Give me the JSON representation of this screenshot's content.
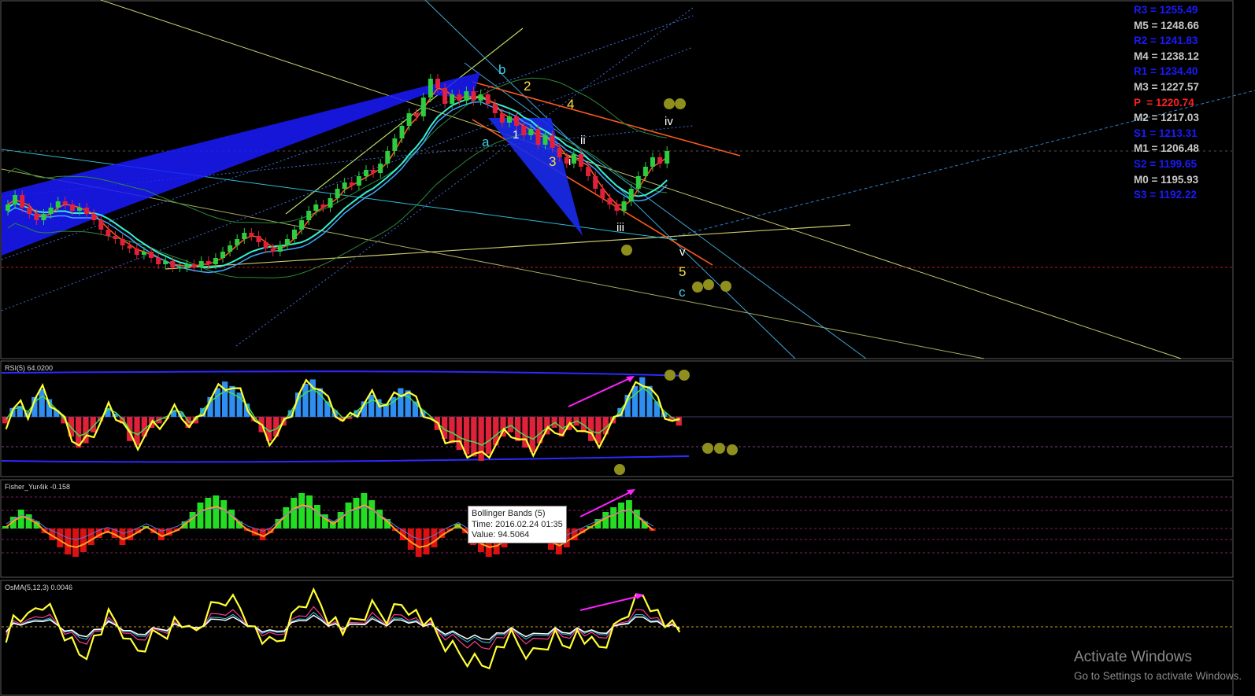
{
  "colors": {
    "background": "#000000",
    "bull_candle": "#2ecc40",
    "bear_candle": "#e0213a",
    "rsi_up_hist": "#2f8ff0",
    "rsi_down_hist": "#e0213a",
    "fisher_up_hist": "#22dd22",
    "fisher_down_hist": "#dd1111",
    "signal_yellow": "#ffff33",
    "annotation_arrow": "#ff22ff",
    "marker_dot": "#8f8f1e",
    "pivot_resistance": "#1a1aff",
    "pivot_mid": "#c8c8c8",
    "pivot_main": "#ff2020"
  },
  "pivots": [
    {
      "label": "R3 = 1255.49",
      "kind": "resistance"
    },
    {
      "label": "M5 = 1248.66",
      "kind": "mid"
    },
    {
      "label": "R2 = 1241.83",
      "kind": "resistance"
    },
    {
      "label": "M4 = 1238.12",
      "kind": "mid"
    },
    {
      "label": "R1 = 1234.40",
      "kind": "resistance"
    },
    {
      "label": "M3 = 1227.57",
      "kind": "mid"
    },
    {
      "label": "P  = 1220.74",
      "kind": "main"
    },
    {
      "label": "M2 = 1217.03",
      "kind": "mid"
    },
    {
      "label": "S1 = 1213.31",
      "kind": "resistance"
    },
    {
      "label": "M1 = 1206.48",
      "kind": "mid"
    },
    {
      "label": "S2 = 1199.65",
      "kind": "resistance"
    },
    {
      "label": "M0 = 1195.93",
      "kind": "mid"
    },
    {
      "label": "S3 = 1192.22",
      "kind": "resistance"
    }
  ],
  "wave_labels": {
    "b": "b",
    "a": "a",
    "c": "c",
    "n1": "1",
    "n2": "2",
    "n3": "3",
    "n4": "4",
    "n5": "5",
    "r_i": "i",
    "r_ii": "ii",
    "r_iii": "iii",
    "r_iv": "iv",
    "r_v": "v"
  },
  "panels": {
    "rsi": {
      "title": "RSI(5) 64.0200"
    },
    "fisher": {
      "title": "Fisher_Yur4ik -0.158"
    },
    "osma": {
      "title": "OsMA(5,12,3) 0.0046"
    }
  },
  "tooltip": {
    "line1": "Bollinger Bands (5)",
    "line2": "Time: 2016.02.24 01:35",
    "line3": "Value: 94.5064"
  },
  "watermark": {
    "title": "Activate Windows",
    "subtitle": "Go to Settings to activate Windows."
  },
  "chart_data": {
    "type": "candlestick",
    "price_levels": [
      1255.49,
      1248.66,
      1241.83,
      1238.12,
      1234.4,
      1227.57,
      1220.74,
      1217.03,
      1213.31,
      1206.48,
      1199.65,
      1195.93,
      1192.22
    ],
    "close": [
      1208,
      1211,
      1207,
      1205,
      1203,
      1205,
      1207,
      1209,
      1208,
      1206,
      1207,
      1205,
      1203,
      1200,
      1198,
      1197,
      1195,
      1194,
      1192,
      1193,
      1191,
      1189,
      1190,
      1188,
      1188,
      1189,
      1188,
      1190,
      1189,
      1191,
      1193,
      1195,
      1197,
      1199,
      1198,
      1196,
      1194,
      1193,
      1195,
      1197,
      1200,
      1203,
      1206,
      1208,
      1207,
      1210,
      1213,
      1215,
      1214,
      1217,
      1219,
      1218,
      1221,
      1225,
      1229,
      1233,
      1237,
      1236,
      1242,
      1248,
      1245,
      1240,
      1243,
      1241,
      1244,
      1241,
      1243,
      1240,
      1237,
      1234,
      1236,
      1233,
      1230,
      1232,
      1227,
      1230,
      1226,
      1223,
      1221,
      1224,
      1220,
      1217,
      1213,
      1210,
      1208,
      1206,
      1209,
      1213,
      1217,
      1220,
      1223,
      1221,
      1225
    ],
    "rsi_hist": [
      -6,
      8,
      10,
      4,
      18,
      25,
      16,
      6,
      -6,
      -18,
      -28,
      -24,
      -14,
      -4,
      8,
      3,
      -6,
      -22,
      -26,
      -18,
      -10,
      -6,
      -2,
      6,
      4,
      -10,
      -6,
      8,
      18,
      26,
      32,
      28,
      22,
      12,
      -4,
      -14,
      -22,
      -18,
      -8,
      6,
      22,
      30,
      34,
      26,
      14,
      6,
      -4,
      -2,
      6,
      14,
      20,
      16,
      12,
      18,
      26,
      24,
      14,
      6,
      -2,
      -12,
      -20,
      -24,
      -30,
      -34,
      -36,
      -40,
      -34,
      -26,
      -18,
      -14,
      -22,
      -28,
      -32,
      -24,
      -16,
      -10,
      -18,
      -12,
      -8,
      -14,
      -22,
      -24,
      -16,
      -6,
      8,
      20,
      28,
      36,
      28,
      14,
      4,
      -4,
      -8
    ],
    "fisher_hist": [
      2,
      10,
      16,
      12,
      6,
      -4,
      -10,
      -16,
      -22,
      -24,
      -20,
      -14,
      -8,
      -4,
      -8,
      -14,
      -10,
      -4,
      2,
      -4,
      -10,
      -6,
      -2,
      6,
      14,
      22,
      26,
      28,
      24,
      16,
      6,
      -2,
      -6,
      -10,
      -4,
      8,
      18,
      26,
      30,
      28,
      20,
      12,
      6,
      14,
      22,
      26,
      30,
      24,
      16,
      8,
      -2,
      -10,
      -18,
      -24,
      -22,
      -16,
      -8,
      -2,
      4,
      -4,
      -14,
      -20,
      -24,
      -22,
      -16,
      -8,
      -2,
      6,
      -4,
      -12,
      -18,
      -22,
      -16,
      -10,
      -4,
      2,
      8,
      14,
      18,
      22,
      24,
      16,
      6,
      -2
    ]
  }
}
